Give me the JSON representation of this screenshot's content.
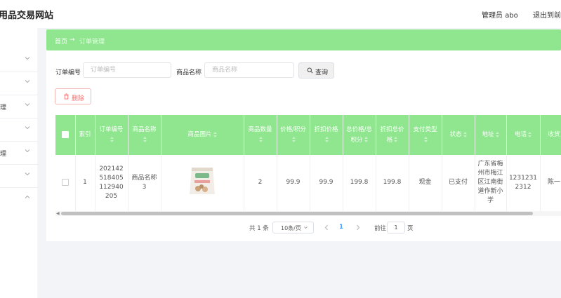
{
  "app": {
    "title": "用品交易网站"
  },
  "header": {
    "user": "管理员 abo",
    "logout": "退出到前"
  },
  "sidebar": {
    "items": [
      {
        "label": ""
      },
      {
        "label": ""
      },
      {
        "label": "理"
      },
      {
        "label": ""
      },
      {
        "label": "理"
      },
      {
        "label": ""
      },
      {
        "label": ""
      }
    ]
  },
  "breadcrumb": {
    "home": "首页",
    "separator": "→",
    "current": "订单管理"
  },
  "filters": {
    "order_no_label": "订单编号",
    "order_no_placeholder": "订单编号",
    "product_name_label": "商品名称",
    "product_name_placeholder": "商品名称",
    "search_label": "查询"
  },
  "actions": {
    "delete_label": "删除"
  },
  "table": {
    "columns": [
      "索引",
      "订单编号",
      "商品名称",
      "商品图片",
      "商品数量",
      "价格/积分",
      "折扣价格",
      "总价格/总积分",
      "折扣总价格",
      "支付类型",
      "状态",
      "地址",
      "电话",
      "收货"
    ],
    "rows": [
      {
        "index": "1",
        "order_no": "202142518405112940205",
        "product_name": "商品名称3",
        "image_alt": "product package",
        "quantity": "2",
        "price": "99.9",
        "discount_price": "99.9",
        "total": "199.8",
        "discount_total": "199.8",
        "pay_type": "现金",
        "status": "已支付",
        "address": "广东省梅州市梅江区江南街道作新小学",
        "phone": "12312312312",
        "receiver": "陈一"
      }
    ]
  },
  "pagination": {
    "total": "共 1 条",
    "page_size": "10条/页",
    "current_page": "1",
    "goto_label": "前往",
    "goto_value": "1",
    "page_unit": "页"
  },
  "colors": {
    "accent": "#8fe68f",
    "danger": "#f56c6c",
    "page_active": "#409eff"
  }
}
